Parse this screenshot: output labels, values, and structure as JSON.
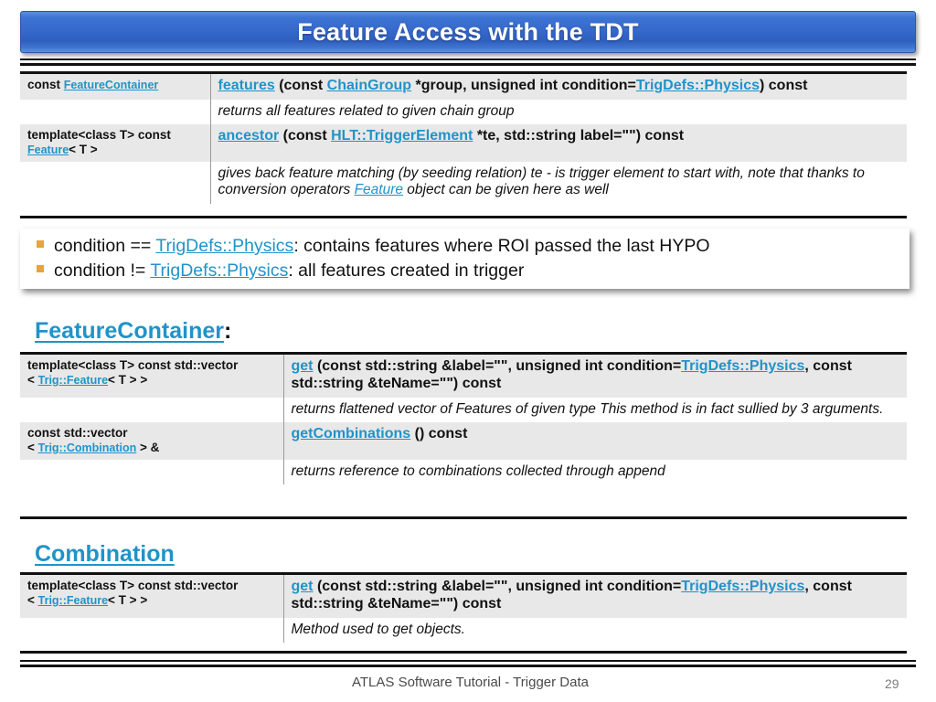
{
  "slide": {
    "title": "Feature Access with the TDT",
    "title_color": "#3467c9",
    "link_color": "#2193c8",
    "bullet_color": "#e8a33a"
  },
  "table_tdt": {
    "rows": [
      {
        "kind": "signature",
        "type_parts": [
          {
            "t": "const ",
            "link": false
          },
          {
            "t": "FeatureContainer",
            "link": true
          }
        ],
        "sig_parts": [
          {
            "t": "features",
            "link": true
          },
          {
            "t": " (const ",
            "link": false
          },
          {
            "t": "ChainGroup",
            "link": true
          },
          {
            "t": " *group, unsigned int condition=",
            "link": false
          },
          {
            "t": "TrigDefs::Physics",
            "link": true
          },
          {
            "t": ") const",
            "link": false
          }
        ]
      },
      {
        "kind": "description",
        "desc_parts": [
          {
            "t": "returns all features related to given chain group",
            "link": false
          }
        ]
      },
      {
        "kind": "signature",
        "type_parts": [
          {
            "t": "template<class T> const ",
            "link": false
          },
          {
            "t": "Feature",
            "link": true
          },
          {
            "t": "< T >",
            "link": false
          }
        ],
        "sig_parts": [
          {
            "t": "ancestor",
            "link": true
          },
          {
            "t": " (const ",
            "link": false
          },
          {
            "t": "HLT::TriggerElement",
            "link": true
          },
          {
            "t": " *te, std::string label=\"\") const",
            "link": false
          }
        ]
      },
      {
        "kind": "description",
        "desc_parts": [
          {
            "t": "gives back feature matching (by seeding relation) te - is trigger element to start with, note that thanks to conversion operators ",
            "link": false
          },
          {
            "t": "Feature",
            "link": true
          },
          {
            "t": " object can be given here as well",
            "link": false
          }
        ]
      }
    ]
  },
  "callout": {
    "bullets": [
      [
        {
          "t": "condition == ",
          "link": false
        },
        {
          "t": "TrigDefs::Physics",
          "link": true
        },
        {
          "t": ": contains features where ROI passed the last HYPO",
          "link": false
        }
      ],
      [
        {
          "t": "condition != ",
          "link": false
        },
        {
          "t": "TrigDefs::Physics",
          "link": true
        },
        {
          "t": ": all features created in trigger",
          "link": false
        }
      ]
    ]
  },
  "heading_feature_container": {
    "label": "FeatureContainer",
    "suffix": ":"
  },
  "table_feature_container": {
    "rows": [
      {
        "kind": "signature",
        "type_parts": [
          {
            "t": "template<class T> const std::vector",
            "link": false
          },
          {
            "t": "\n",
            "link": false
          },
          {
            "t": "< ",
            "link": false
          },
          {
            "t": "Trig::Feature",
            "link": true
          },
          {
            "t": "< T > >",
            "link": false
          }
        ],
        "sig_parts": [
          {
            "t": "get",
            "link": true
          },
          {
            "t": " (const std::string &label=\"\", unsigned int condition=",
            "link": false
          },
          {
            "t": "TrigDefs::Physics",
            "link": true
          },
          {
            "t": ", const std::string &teName=\"\") const",
            "link": false
          }
        ]
      },
      {
        "kind": "description",
        "desc_parts": [
          {
            "t": "returns flattened vector of Features of given type This method is in fact sullied by 3 arguments.",
            "link": false
          }
        ]
      },
      {
        "kind": "signature",
        "type_parts": [
          {
            "t": "const std::vector",
            "link": false
          },
          {
            "t": "\n",
            "link": false
          },
          {
            "t": "< ",
            "link": false
          },
          {
            "t": "Trig::Combination",
            "link": true
          },
          {
            "t": " > &",
            "link": false
          }
        ],
        "sig_parts": [
          {
            "t": "getCombinations",
            "link": true
          },
          {
            "t": " () const",
            "link": false
          }
        ]
      },
      {
        "kind": "description",
        "desc_parts": [
          {
            "t": "returns reference to combinations collected through append",
            "link": false
          }
        ]
      }
    ]
  },
  "heading_combination": {
    "label": "Combination",
    "suffix": ""
  },
  "table_combination": {
    "rows": [
      {
        "kind": "signature",
        "type_parts": [
          {
            "t": "template<class T> const std::vector",
            "link": false
          },
          {
            "t": "\n",
            "link": false
          },
          {
            "t": "< ",
            "link": false
          },
          {
            "t": "Trig::Feature",
            "link": true
          },
          {
            "t": "< T > >",
            "link": false
          }
        ],
        "sig_parts": [
          {
            "t": "get",
            "link": true
          },
          {
            "t": " (const std::string &label=\"\", unsigned int condition=",
            "link": false
          },
          {
            "t": "TrigDefs::Physics",
            "link": true
          },
          {
            "t": ", const std::string &teName=\"\") const",
            "link": false
          }
        ]
      },
      {
        "kind": "description",
        "desc_parts": [
          {
            "t": "Method used to get objects.",
            "link": false
          }
        ]
      }
    ]
  },
  "footer": {
    "text": "ATLAS Software Tutorial - Trigger Data",
    "page_number": "29"
  }
}
